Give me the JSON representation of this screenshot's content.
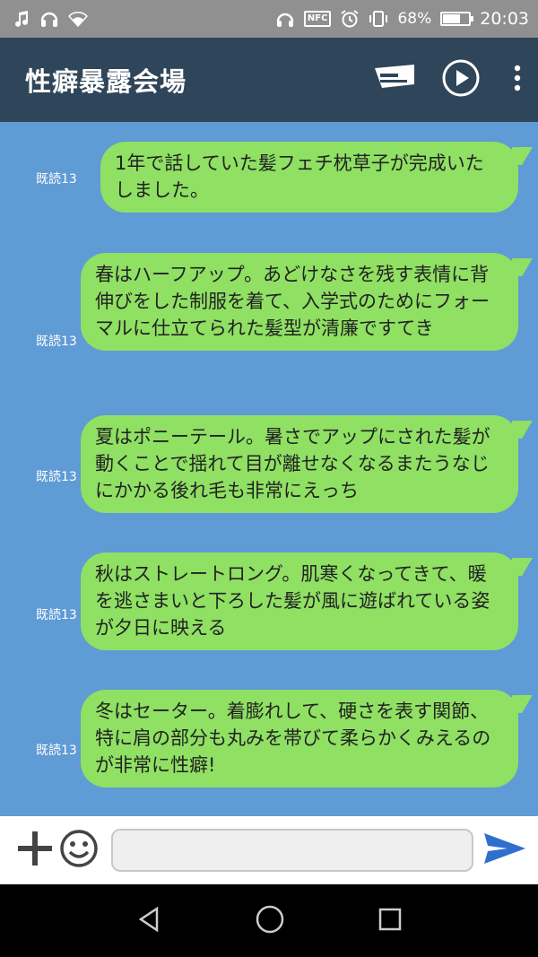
{
  "status_bar": {
    "left_icons": [
      "music-note-icon",
      "headset-icon",
      "wifi-icon"
    ],
    "right_icons": [
      "headphones-icon",
      "nfc-icon",
      "alarm-icon",
      "vibrate-icon"
    ],
    "nfc_label": "NFC",
    "battery_percent": "68%",
    "battery_level": 0.68,
    "time": "20:03"
  },
  "header": {
    "title": "性癖暴露会場",
    "icons": [
      "message-card-icon",
      "play-circle-icon",
      "more-vert-icon"
    ]
  },
  "messages": [
    {
      "read": "既読13",
      "text": "1年で話していた髪フェチ枕草子が完成いたしました。"
    },
    {
      "read": "既読13",
      "text": "春はハーフアップ。あどけなさを残す表情に背伸びをした制服を着て、入学式のためにフォーマルに仕立てられた髪型が清廉ですてき"
    },
    {
      "read": "既読13",
      "text": "夏はポニーテール。暑さでアップにされた髪が動くことで揺れて目が離せなくなるまたうなじにかかる後れ毛も非常にえっち"
    },
    {
      "read": "既読13",
      "text": "秋はストレートロング。肌寒くなってきて、暖を逃さまいと下ろした髪が風に遊ばれている姿が夕日に映える"
    },
    {
      "read": "既読13",
      "text": "冬はセーター。着膨れして、硬さを表す関節、特に肩の部分も丸みを帯びて柔らかくみえるのが非常に性癖!"
    }
  ],
  "input_bar": {
    "placeholder": "",
    "icons": [
      "plus-icon",
      "emoji-icon",
      "send-icon"
    ]
  },
  "nav_bar": {
    "icons": [
      "back-icon",
      "home-icon",
      "recents-icon"
    ]
  },
  "colors": {
    "status_bar": "#909090",
    "header": "#2f4559",
    "chat_background": "#5f9bd4",
    "bubble": "#8fe063",
    "send": "#2f6fd0"
  }
}
